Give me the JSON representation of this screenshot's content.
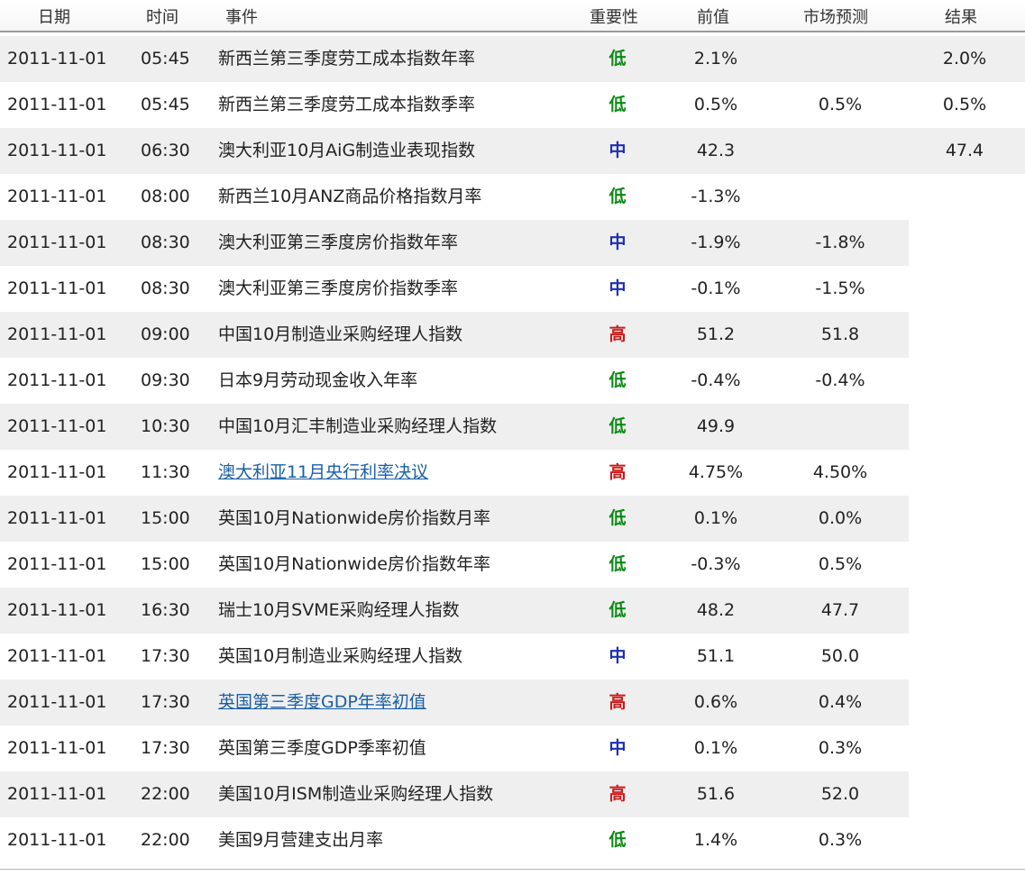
{
  "header": {
    "date": "日期",
    "time": "时间",
    "event": "事件",
    "importance": "重要性",
    "previous": "前值",
    "forecast": "市场预测",
    "result": "结果"
  },
  "importance_colors": {
    "低": "#0b8a13",
    "中": "#1f2fb4",
    "高": "#cc1a1a"
  },
  "rows": [
    {
      "date": "2011-11-01",
      "time": "05:45",
      "event": "新西兰第三季度劳工成本指数年率",
      "link": false,
      "importance": "低",
      "previous": "2.1%",
      "forecast": "",
      "result": "2.0%"
    },
    {
      "date": "2011-11-01",
      "time": "05:45",
      "event": "新西兰第三季度劳工成本指数季率",
      "link": false,
      "importance": "低",
      "previous": "0.5%",
      "forecast": "0.5%",
      "result": "0.5%"
    },
    {
      "date": "2011-11-01",
      "time": "06:30",
      "event": "澳大利亚10月AiG制造业表现指数",
      "link": false,
      "importance": "中",
      "previous": "42.3",
      "forecast": "",
      "result": "47.4"
    },
    {
      "date": "2011-11-01",
      "time": "08:00",
      "event": "新西兰10月ANZ商品价格指数月率",
      "link": false,
      "importance": "低",
      "previous": "-1.3%",
      "forecast": "",
      "result": ""
    },
    {
      "date": "2011-11-01",
      "time": "08:30",
      "event": "澳大利亚第三季度房价指数年率",
      "link": false,
      "importance": "中",
      "previous": "-1.9%",
      "forecast": "-1.8%",
      "result": ""
    },
    {
      "date": "2011-11-01",
      "time": "08:30",
      "event": "澳大利亚第三季度房价指数季率",
      "link": false,
      "importance": "中",
      "previous": "-0.1%",
      "forecast": "-1.5%",
      "result": ""
    },
    {
      "date": "2011-11-01",
      "time": "09:00",
      "event": "中国10月制造业采购经理人指数",
      "link": false,
      "importance": "高",
      "previous": "51.2",
      "forecast": "51.8",
      "result": ""
    },
    {
      "date": "2011-11-01",
      "time": "09:30",
      "event": "日本9月劳动现金收入年率",
      "link": false,
      "importance": "低",
      "previous": "-0.4%",
      "forecast": "-0.4%",
      "result": ""
    },
    {
      "date": "2011-11-01",
      "time": "10:30",
      "event": "中国10月汇丰制造业采购经理人指数",
      "link": false,
      "importance": "低",
      "previous": "49.9",
      "forecast": "",
      "result": ""
    },
    {
      "date": "2011-11-01",
      "time": "11:30",
      "event": "澳大利亚11月央行利率决议",
      "link": true,
      "importance": "高",
      "previous": "4.75%",
      "forecast": "4.50%",
      "result": ""
    },
    {
      "date": "2011-11-01",
      "time": "15:00",
      "event": "英国10月Nationwide房价指数月率",
      "link": false,
      "importance": "低",
      "previous": "0.1%",
      "forecast": "0.0%",
      "result": ""
    },
    {
      "date": "2011-11-01",
      "time": "15:00",
      "event": "英国10月Nationwide房价指数年率",
      "link": false,
      "importance": "低",
      "previous": "-0.3%",
      "forecast": "0.5%",
      "result": ""
    },
    {
      "date": "2011-11-01",
      "time": "16:30",
      "event": "瑞士10月SVME采购经理人指数",
      "link": false,
      "importance": "低",
      "previous": "48.2",
      "forecast": "47.7",
      "result": ""
    },
    {
      "date": "2011-11-01",
      "time": "17:30",
      "event": "英国10月制造业采购经理人指数",
      "link": false,
      "importance": "中",
      "previous": "51.1",
      "forecast": "50.0",
      "result": ""
    },
    {
      "date": "2011-11-01",
      "time": "17:30",
      "event": "英国第三季度GDP年率初值",
      "link": true,
      "importance": "高",
      "previous": "0.6%",
      "forecast": "0.4%",
      "result": ""
    },
    {
      "date": "2011-11-01",
      "time": "17:30",
      "event": "英国第三季度GDP季率初值",
      "link": false,
      "importance": "中",
      "previous": "0.1%",
      "forecast": "0.3%",
      "result": ""
    },
    {
      "date": "2011-11-01",
      "time": "22:00",
      "event": "美国10月ISM制造业采购经理人指数",
      "link": false,
      "importance": "高",
      "previous": "51.6",
      "forecast": "52.0",
      "result": ""
    },
    {
      "date": "2011-11-01",
      "time": "22:00",
      "event": "美国9月营建支出月率",
      "link": false,
      "importance": "低",
      "previous": "1.4%",
      "forecast": "0.3%",
      "result": ""
    }
  ]
}
